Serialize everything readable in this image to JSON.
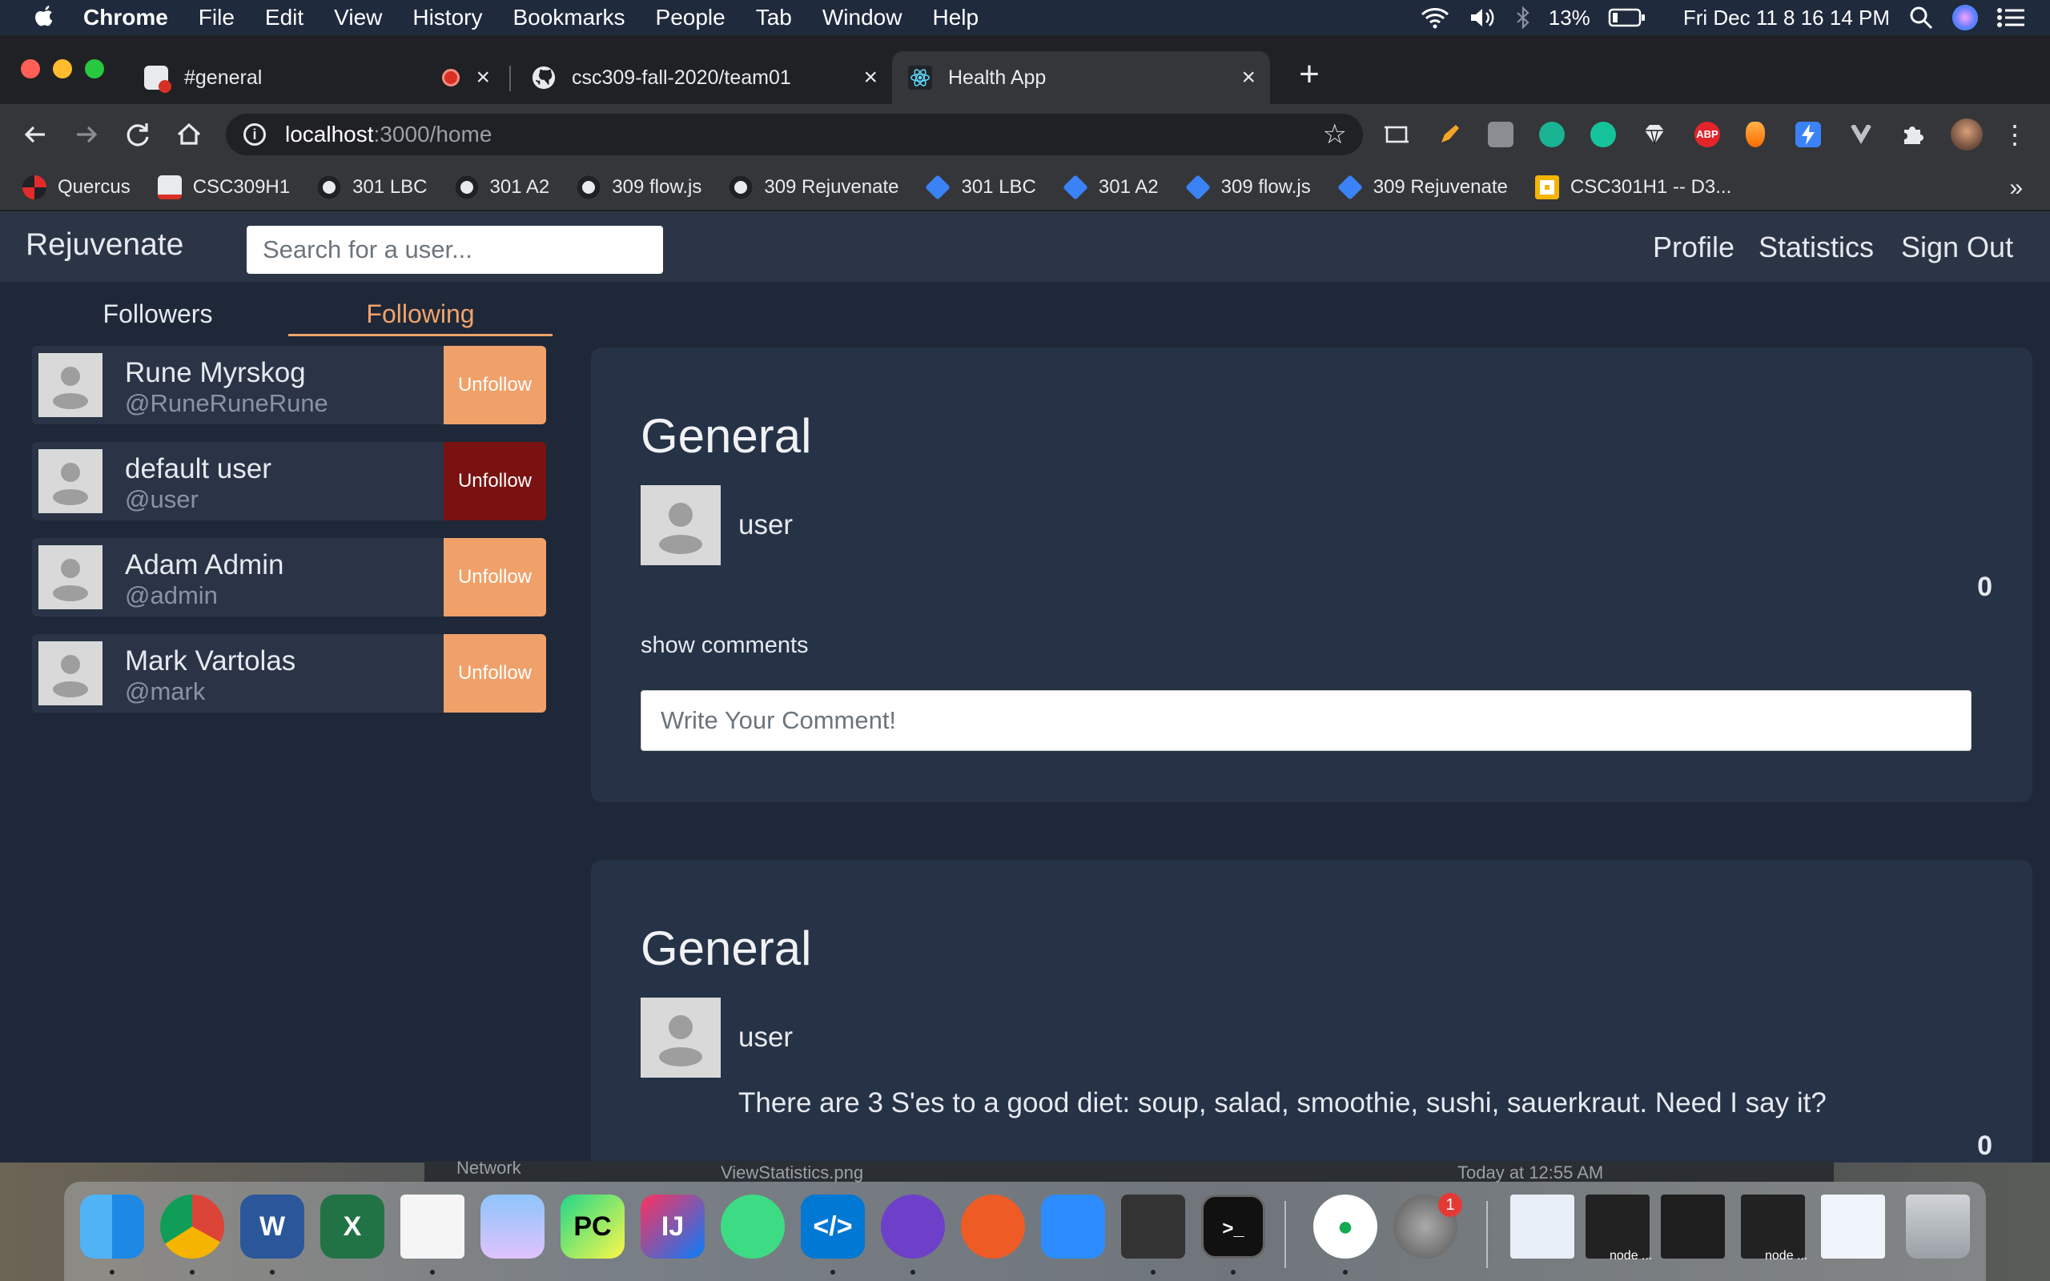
{
  "menubar": {
    "app_name": "Chrome",
    "items": [
      "File",
      "Edit",
      "View",
      "History",
      "Bookmarks",
      "People",
      "Tab",
      "Window",
      "Help"
    ],
    "battery": "13%",
    "datetime": "Fri Dec 11  8 16 14 PM"
  },
  "tabs": [
    {
      "title": "#general",
      "recording": true
    },
    {
      "title": "csc309-fall-2020/team01"
    },
    {
      "title": "Health App",
      "active": true
    }
  ],
  "omnibox": {
    "host": "localhost",
    "path": ":3000/home"
  },
  "bookmarks": [
    {
      "label": "Quercus",
      "icon": "quercus-icon"
    },
    {
      "label": "CSC309H1",
      "icon": "quercus-course-icon"
    },
    {
      "label": "301 LBC",
      "icon": "github-icon"
    },
    {
      "label": "301 A2",
      "icon": "github-icon"
    },
    {
      "label": "309 flow.js",
      "icon": "github-icon"
    },
    {
      "label": "309 Rejuvenate",
      "icon": "github-icon"
    },
    {
      "label": "301 LBC",
      "icon": "jira-icon"
    },
    {
      "label": "301 A2",
      "icon": "jira-icon"
    },
    {
      "label": "309 flow.js",
      "icon": "jira-icon"
    },
    {
      "label": "309 Rejuvenate",
      "icon": "jira-icon"
    },
    {
      "label": "CSC301H1 -- D3...",
      "icon": "slides-icon"
    }
  ],
  "app": {
    "brand": "Rejuvenate",
    "search_placeholder": "Search for a user...",
    "nav": {
      "profile": "Profile",
      "statistics": "Statistics",
      "signout": "Sign Out"
    },
    "sidebar_tabs": {
      "followers": "Followers",
      "following": "Following"
    },
    "following": [
      {
        "name": "Rune Myrskog",
        "handle": "@RuneRuneRune",
        "button": "Unfollow"
      },
      {
        "name": "default user",
        "handle": "@user",
        "button": "Unfollow",
        "hovered": true
      },
      {
        "name": "Adam Admin",
        "handle": "@admin",
        "button": "Unfollow"
      },
      {
        "name": "Mark Vartolas",
        "handle": "@mark",
        "button": "Unfollow"
      }
    ],
    "posts": [
      {
        "title": "General",
        "user": "user",
        "body": "",
        "likes": "0",
        "show_comments": "show comments",
        "comment_placeholder": "Write Your Comment!"
      },
      {
        "title": "General",
        "user": "user",
        "body": "There are 3 S'es to a good diet: soup, salad, smoothie, sushi, sauerkraut. Need I say it?",
        "likes": "0"
      }
    ]
  },
  "desktop": {
    "file1": "ViewStatistics.png",
    "file1_date": "Today at 12:55 AM",
    "network": "Network"
  },
  "dock": {
    "apps": [
      "finder-icon",
      "chrome-icon",
      "word-icon",
      "excel-icon",
      "textedit-icon",
      "preview-icon",
      "pycharm-icon",
      "intellij-icon",
      "android-studio-icon",
      "vscode-icon",
      "github-desktop-icon",
      "postman-icon",
      "zoom-icon",
      "printer-icon",
      "terminal-icon",
      "mongodb-compass-icon",
      "system-preferences-icon"
    ],
    "sysprefs_badge": "1",
    "window_labels": [
      "node ...",
      "node ..."
    ]
  },
  "colors": {
    "accent": "#f0a36a",
    "unfollow_hover": "#7a1212",
    "app_bg": "#1f2838",
    "card_bg": "#263246"
  }
}
